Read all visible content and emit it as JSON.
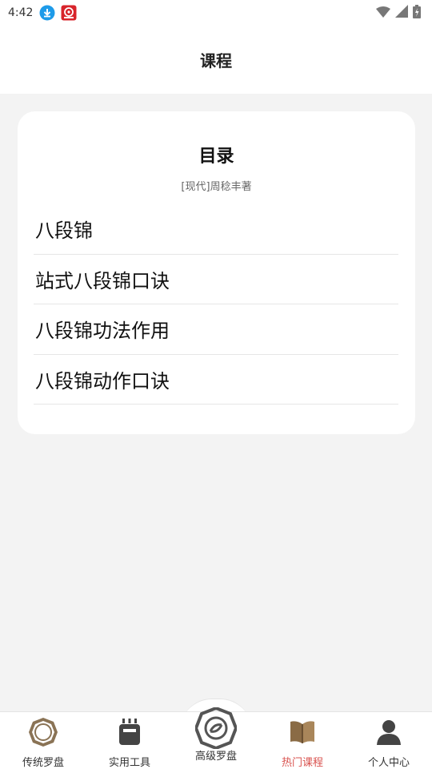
{
  "status_bar": {
    "time": "4:42",
    "notification_icons": [
      "download-icon",
      "app-notification-icon"
    ],
    "system_icons": [
      "wifi-icon",
      "signal-icon",
      "battery-icon"
    ]
  },
  "header": {
    "title": "课程"
  },
  "card": {
    "title": "目录",
    "author": "[现代]周稔丰著",
    "items": [
      {
        "label": "八段锦"
      },
      {
        "label": "站式八段锦口诀"
      },
      {
        "label": "八段锦功法作用"
      },
      {
        "label": "八段锦动作口诀"
      }
    ]
  },
  "tabbar": {
    "active_color": "#d9534f",
    "tabs": [
      {
        "label": "传统罗盘",
        "icon": "compass-icon"
      },
      {
        "label": "实用工具",
        "icon": "toolbox-icon"
      },
      {
        "label": "高级罗盘",
        "icon": "advanced-compass-icon"
      },
      {
        "label": "热门课程",
        "icon": "book-icon",
        "active": true
      },
      {
        "label": "个人中心",
        "icon": "profile-icon"
      }
    ]
  }
}
